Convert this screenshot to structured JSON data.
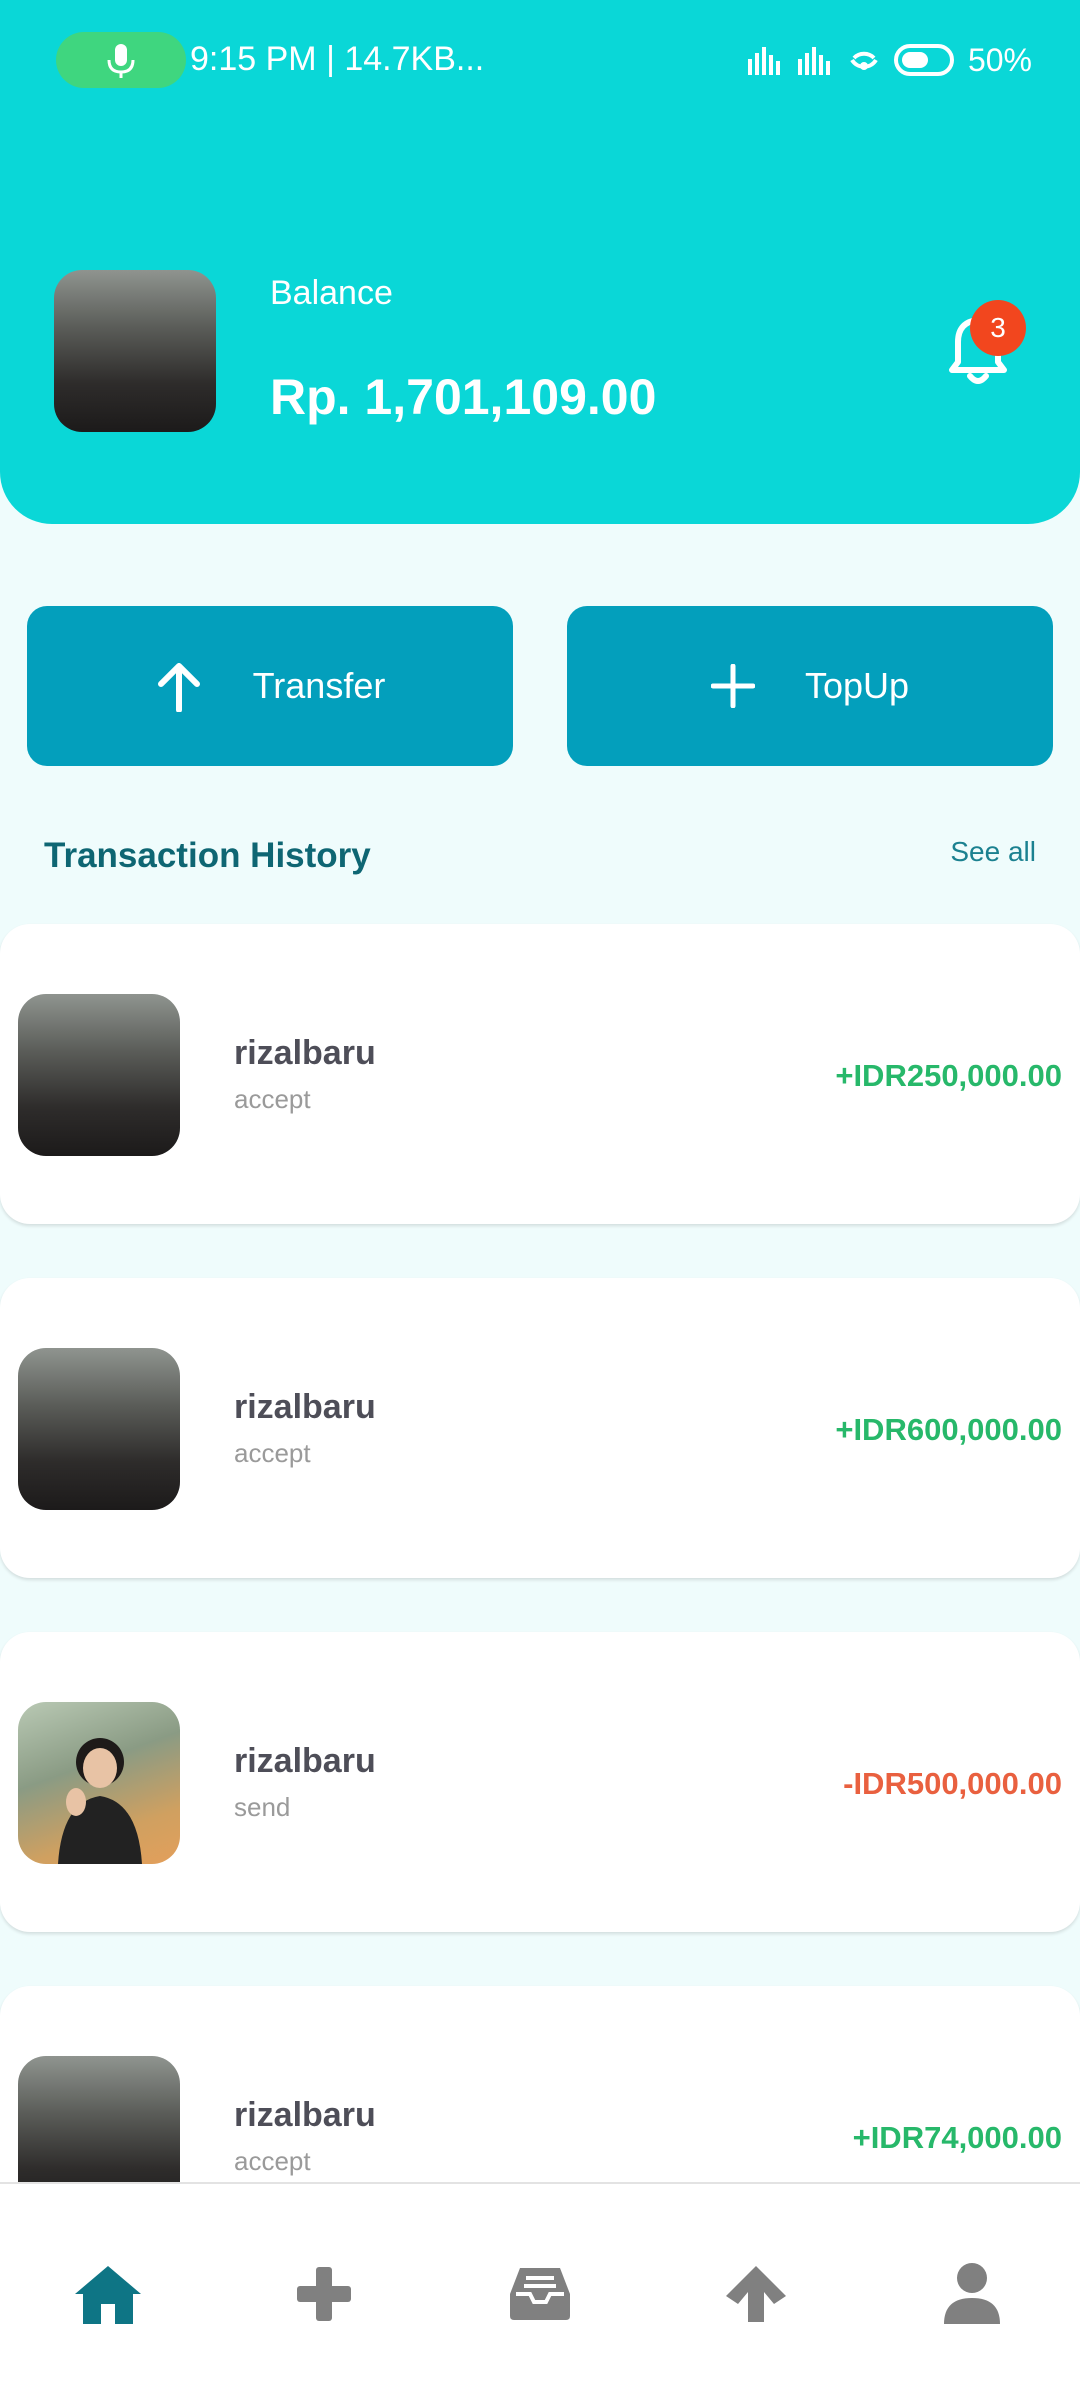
{
  "status_bar": {
    "time_info": "9:15 PM | 14.7KB...",
    "battery": "50%"
  },
  "header": {
    "balance_label": "Balance",
    "balance_value": "Rp. 1,701,109.00",
    "notification_count": "3"
  },
  "actions": {
    "transfer_label": "Transfer",
    "topup_label": "TopUp"
  },
  "history": {
    "title": "Transaction History",
    "see_all": "See all",
    "items": [
      {
        "name": "rizalbaru",
        "status": "accept",
        "amount": "+IDR250,000.00"
      },
      {
        "name": "rizalbaru",
        "status": "accept",
        "amount": "+IDR600,000.00"
      },
      {
        "name": "rizalbaru",
        "status": "send",
        "amount": "-IDR500,000.00"
      },
      {
        "name": "rizalbaru",
        "status": "accept",
        "amount": "+IDR74,000.00"
      }
    ]
  },
  "nav": {
    "icons": [
      "home-icon",
      "plus-icon",
      "inbox-icon",
      "arrow-up-icon",
      "user-icon"
    ],
    "active": "home-icon"
  },
  "colors": {
    "header_bg": "#0ad7d7",
    "button_bg": "#039fbc",
    "positive": "#27b86a",
    "negative": "#e9603f",
    "nav_active": "#0e7585",
    "nav_inactive": "#808080"
  }
}
